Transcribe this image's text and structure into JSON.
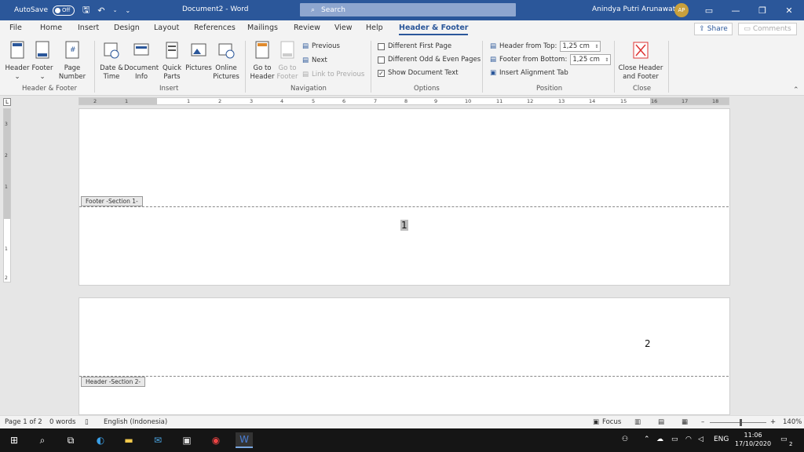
{
  "window": {
    "autosave_label": "AutoSave",
    "autosave_state": "Off",
    "title": "Document2  -  Word",
    "search_placeholder": "Search",
    "user_name": "Anindya Putri Arunawati",
    "user_initials": "AP"
  },
  "tabs": [
    "File",
    "Home",
    "Insert",
    "Design",
    "Layout",
    "References",
    "Mailings",
    "Review",
    "View",
    "Help",
    "Header & Footer"
  ],
  "share_label": "Share",
  "comments_label": "Comments",
  "ribbon": {
    "hf": {
      "header": "Header",
      "footer": "Footer",
      "page_number_1": "Page",
      "page_number_2": "Number",
      "group": "Header & Footer"
    },
    "insert": {
      "datetime_1": "Date &",
      "datetime_2": "Time",
      "docinfo_1": "Document",
      "docinfo_2": "Info",
      "quickparts_1": "Quick",
      "quickparts_2": "Parts",
      "pictures": "Pictures",
      "online_1": "Online",
      "online_2": "Pictures",
      "group": "Insert"
    },
    "navigation": {
      "goto_header_1": "Go to",
      "goto_header_2": "Header",
      "goto_footer_1": "Go to",
      "goto_footer_2": "Footer",
      "previous": "Previous",
      "next": "Next",
      "link_previous": "Link to Previous",
      "group": "Navigation"
    },
    "options": {
      "diff_first": "Different First Page",
      "diff_odd_even": "Different Odd & Even Pages",
      "show_doc_text": "Show Document Text",
      "group": "Options"
    },
    "position": {
      "header_from_top": "Header from Top:",
      "header_value": "1,25 cm",
      "footer_from_bottom": "Footer from Bottom:",
      "footer_value": "1,25 cm",
      "insert_align_tab": "Insert Alignment Tab",
      "group": "Position"
    },
    "close": {
      "close_1": "Close Header",
      "close_2": "and Footer",
      "group": "Close"
    }
  },
  "ruler_ticks": [
    "2",
    "1",
    "1",
    "2",
    "3",
    "4",
    "5",
    "6",
    "7",
    "8",
    "9",
    "10",
    "11",
    "12",
    "13",
    "14",
    "15",
    "16",
    "17",
    "18"
  ],
  "vruler_ticks": [
    "3",
    "2",
    "1",
    "1",
    "2"
  ],
  "document": {
    "footer_tag": "Footer -Section 1-",
    "page1_number": "1",
    "page2_number": "2",
    "header_tag": "Header -Section 2-"
  },
  "status": {
    "page": "Page 1 of 2",
    "words": "0 words",
    "language": "English (Indonesia)",
    "focus": "Focus",
    "zoom": "140%"
  },
  "taskbar": {
    "language": "ENG",
    "time": "11:06",
    "date": "17/10/2020",
    "notifications": "2"
  }
}
